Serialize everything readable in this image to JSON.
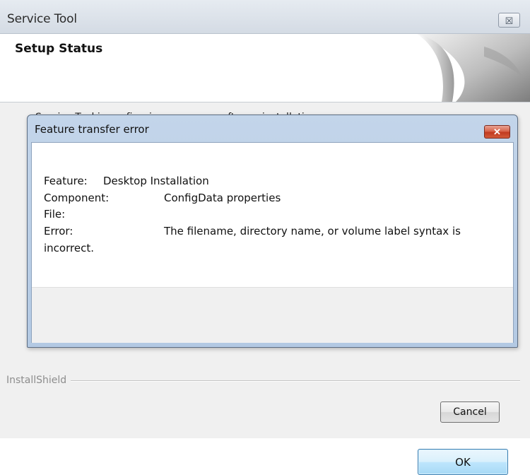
{
  "outer_window": {
    "title": "Service Tool",
    "close_glyph": "☒",
    "header_title": "Setup Status",
    "status_text": "Service Tool is configuring your new software installation.",
    "installshield_label": "InstallShield",
    "cancel_label": "Cancel"
  },
  "dialog": {
    "title": "Feature transfer error",
    "close_glyph": "✕",
    "feature_label": "Feature:",
    "feature_value": "Desktop Installation",
    "component_label": "Component:",
    "component_value": "ConfigData properties",
    "file_label": "File:",
    "error_label": "Error:",
    "error_value": "The filename, directory name, or volume label syntax is",
    "error_value_continued": "incorrect.",
    "ok_label": "OK"
  },
  "colors": {
    "dialog_frame": "#b3c9e3",
    "close_button_red": "#c23a1f",
    "ok_button_border": "#3c7fb1"
  },
  "icons": {
    "outer_close": "close-icon",
    "dialog_close": "close-icon",
    "header_art": "page-curl-graphic"
  }
}
